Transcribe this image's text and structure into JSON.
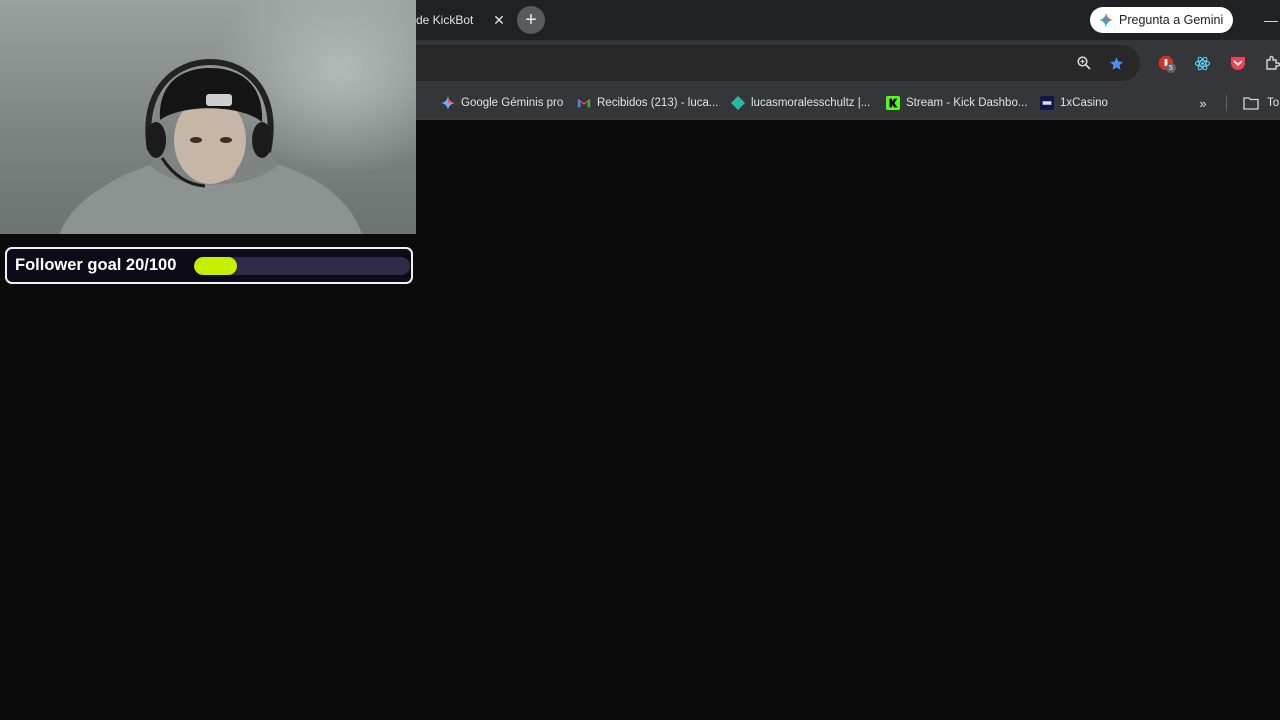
{
  "browser": {
    "tab": {
      "title": "de KickBot",
      "close_glyph": "✕"
    },
    "new_tab_glyph": "+",
    "gemini_button": {
      "label": "Pregunta a Gemini"
    },
    "window_minimize_glyph": "—",
    "omnibox": {
      "zoom_icon": "zoom-icon",
      "bookmark_star_icon": "bookmark-star-icon"
    },
    "extensions": [
      {
        "name": "adblock-extension-icon",
        "badge": "5"
      },
      {
        "name": "react-devtools-extension-icon"
      },
      {
        "name": "pocket-extension-icon"
      },
      {
        "name": "extensions-puzzle-icon"
      }
    ],
    "bookmarks": [
      {
        "label": "Google Géminis pro",
        "icon": "gemini-spark-icon"
      },
      {
        "label": "Recibidos (213) - luca...",
        "icon": "gmail-icon"
      },
      {
        "label": "lucasmoralesschultz |...",
        "icon": "diamond-icon"
      },
      {
        "label": "Stream - Kick Dashbo...",
        "icon": "kick-icon"
      },
      {
        "label": "1xCasino",
        "icon": "casino-icon"
      }
    ],
    "bookmarks_overflow_glyph": "»",
    "bookmarks_folder": {
      "label": "To",
      "icon": "folder-icon"
    }
  },
  "overlay": {
    "follower_goal": {
      "label": "Follower goal 20/100",
      "current": 20,
      "target": 100,
      "bar_color": "#c4f000",
      "track_color": "#2f2b47"
    }
  },
  "colors": {
    "tabstrip": "#202124",
    "toolbar": "#35363a",
    "page_background": "#0b0b0b",
    "accent_star": "#4c8df6"
  }
}
